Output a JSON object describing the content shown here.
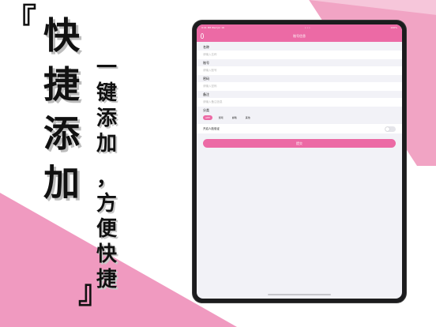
{
  "promo": {
    "bracket_open": "『",
    "bracket_close": "』",
    "big_chars": [
      "快",
      "捷",
      "添",
      "加"
    ],
    "small_chars_1": [
      "一",
      "键",
      "添",
      "加"
    ],
    "small_chars_2": [
      "，",
      "方",
      "便",
      "快",
      "捷"
    ]
  },
  "status_bar": {
    "left": "9:41 PM   Wed Jul 16",
    "center": "• • •",
    "right": "100%"
  },
  "nav": {
    "title": "账号信息",
    "icon": "logo-icon"
  },
  "form": {
    "fields": [
      {
        "label": "名称",
        "placeholder": "请输入名称"
      },
      {
        "label": "账号",
        "placeholder": "请输入账号"
      },
      {
        "label": "密码",
        "placeholder": "请输入密码"
      },
      {
        "label": "备注",
        "placeholder": "请输入备注信息"
      }
    ],
    "category_label": "分类",
    "tags": [
      "APP",
      "游戏",
      "邮箱",
      "其他"
    ],
    "selected_tag": "APP",
    "toggle_label": "开启人脸验证",
    "toggle_on": false,
    "submit_label": "提交"
  },
  "colors": {
    "accent": "#ec6aa5",
    "bg_pink": "#f09ac0"
  }
}
